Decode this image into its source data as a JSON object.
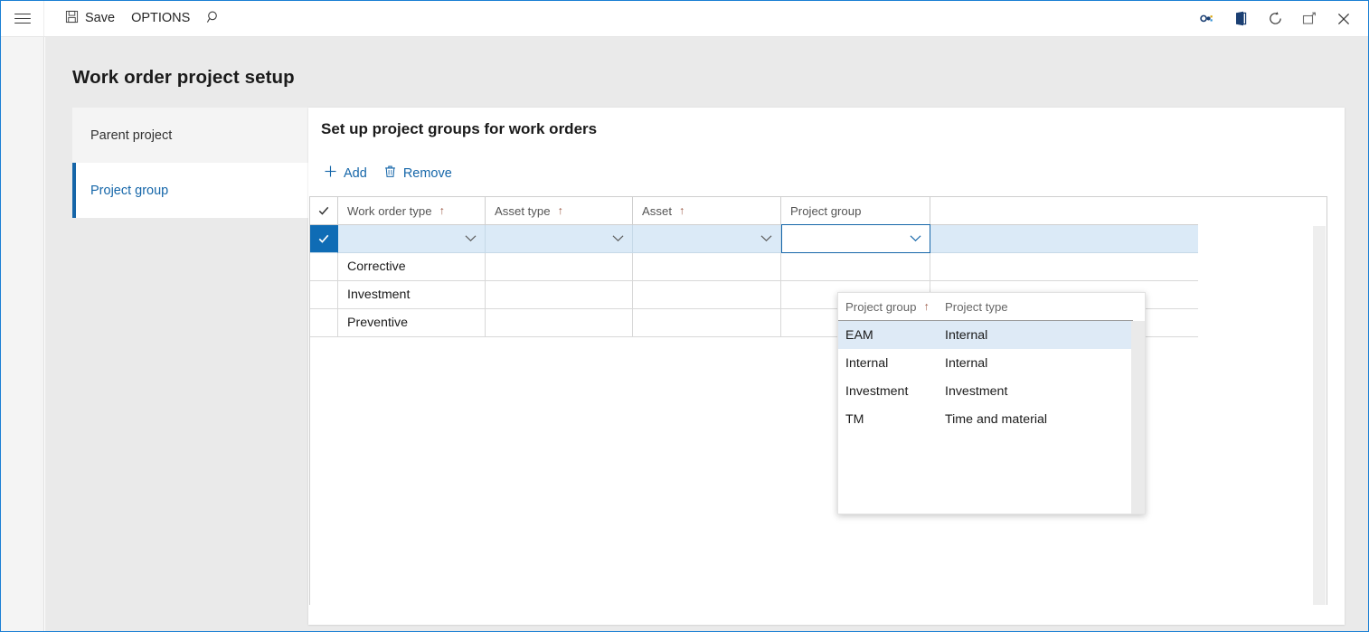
{
  "window": {
    "accent_color": "#1566a9",
    "border_color": "#1a7fd4"
  },
  "topbar": {
    "menu_icon": "hamburger-icon",
    "save_label": "Save",
    "save_icon": "save-disk-icon",
    "options_label": "OPTIONS",
    "search_icon": "search-icon",
    "win_icons": [
      "settings-multicolor-icon",
      "office-app-icon",
      "refresh-icon",
      "restore-window-icon",
      "close-icon"
    ]
  },
  "page": {
    "title": "Work order project setup"
  },
  "sections": [
    {
      "label": "Parent project",
      "selected": false
    },
    {
      "label": "Project group",
      "selected": true
    }
  ],
  "panel": {
    "title": "Set up project groups for work orders",
    "toolbar": {
      "add_label": "Add",
      "add_icon": "plus-icon",
      "remove_label": "Remove",
      "remove_icon": "trash-icon"
    }
  },
  "grid": {
    "select_all_icon": "checkmark-icon",
    "columns": [
      {
        "label": "Work order type",
        "sorted": true,
        "sort_arrow": "↑"
      },
      {
        "label": "Asset type",
        "sorted": true,
        "sort_arrow": "↑"
      },
      {
        "label": "Asset",
        "sorted": true,
        "sort_arrow": "↑"
      },
      {
        "label": "Project group",
        "sorted": false,
        "sort_arrow": ""
      }
    ],
    "editing_row": {
      "checked": true,
      "check_icon": "checkmark-icon",
      "work_order_type": "",
      "asset_type": "",
      "asset": "",
      "project_group": "",
      "caret_icon": "chevron-down-icon"
    },
    "rows": [
      {
        "work_order_type": "Corrective",
        "asset_type": "",
        "asset": "",
        "project_group": ""
      },
      {
        "work_order_type": "Investment",
        "asset_type": "",
        "asset": "",
        "project_group": ""
      },
      {
        "work_order_type": "Preventive",
        "asset_type": "",
        "asset": "",
        "project_group": ""
      }
    ]
  },
  "lookup": {
    "open": true,
    "columns": [
      {
        "label": "Project group",
        "sorted": true,
        "sort_arrow": "↑"
      },
      {
        "label": "Project type",
        "sorted": false,
        "sort_arrow": ""
      }
    ],
    "rows": [
      {
        "project_group": "EAM",
        "project_type": "Internal",
        "highlighted": true
      },
      {
        "project_group": "Internal",
        "project_type": "Internal",
        "highlighted": false
      },
      {
        "project_group": "Investment",
        "project_type": "Investment",
        "highlighted": false
      },
      {
        "project_group": "TM",
        "project_type": "Time and material",
        "highlighted": false
      }
    ]
  }
}
